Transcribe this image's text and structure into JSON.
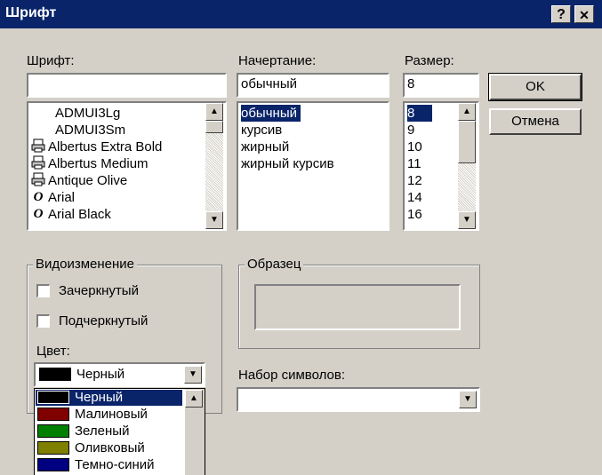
{
  "window": {
    "title": "Шрифт",
    "help_button": "?",
    "close_button": "✕"
  },
  "font": {
    "label": "Шрифт:",
    "value": "",
    "items": [
      {
        "name": "ADMUI3Lg",
        "icon": ""
      },
      {
        "name": "ADMUI3Sm",
        "icon": ""
      },
      {
        "name": "Albertus Extra Bold",
        "icon": "printer-font-icon"
      },
      {
        "name": "Albertus Medium",
        "icon": "printer-font-icon"
      },
      {
        "name": "Antique Olive",
        "icon": "printer-font-icon"
      },
      {
        "name": "Arial",
        "icon": "opentype-icon"
      },
      {
        "name": "Arial Black",
        "icon": "opentype-icon"
      }
    ]
  },
  "style": {
    "label": "Начертание:",
    "value": "обычный",
    "items": [
      "обычный",
      "курсив",
      "жирный",
      "жирный курсив"
    ],
    "selected": "обычный"
  },
  "size": {
    "label": "Размер:",
    "value": "8",
    "items": [
      "8",
      "9",
      "10",
      "11",
      "12",
      "14",
      "16"
    ],
    "selected": "8"
  },
  "buttons": {
    "ok": "OK",
    "cancel": "Отмена"
  },
  "effects": {
    "label": "Видоизменение",
    "strikeout": "Зачеркнутый",
    "underline": "Подчеркнутый",
    "strikeout_checked": false,
    "underline_checked": false
  },
  "color": {
    "label": "Цвет:",
    "selected": "Черный",
    "selected_hex": "#000000",
    "options": [
      {
        "name": "Черный",
        "hex": "#000000"
      },
      {
        "name": "Малиновый",
        "hex": "#800000"
      },
      {
        "name": "Зеленый",
        "hex": "#008000"
      },
      {
        "name": "Оливковый",
        "hex": "#808000"
      },
      {
        "name": "Темно-синий",
        "hex": "#000080"
      }
    ]
  },
  "sample": {
    "label": "Образец"
  },
  "charset": {
    "label": "Набор символов:",
    "value": ""
  },
  "theme": {
    "titlebar": "#0a246a",
    "dialog_bg": "#d4d0c8",
    "selection": "#0a246a"
  }
}
